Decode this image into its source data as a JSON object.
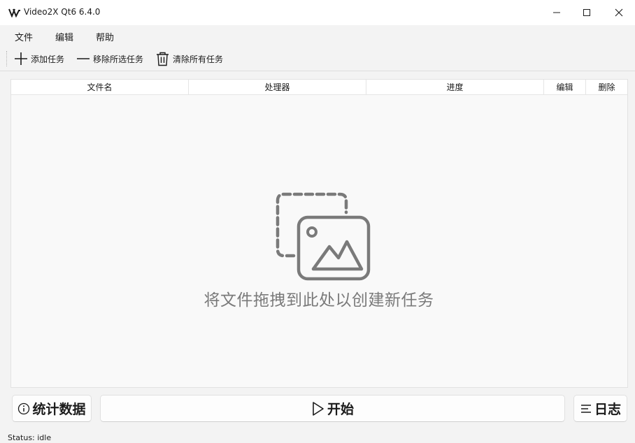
{
  "window": {
    "title": "Video2X Qt6 6.4.0",
    "app_icon": "video2x-logo-icon"
  },
  "title_controls": {
    "minimize": "minimize-icon",
    "maximize": "maximize-icon",
    "close": "close-icon"
  },
  "menu": {
    "items": [
      "文件",
      "编辑",
      "帮助"
    ]
  },
  "toolbar": {
    "add_label": "添加任务",
    "remove_label": "移除所选任务",
    "clear_label": "清除所有任务"
  },
  "table": {
    "columns": [
      "文件名",
      "处理器",
      "进度",
      "编辑",
      "删除"
    ],
    "rows": []
  },
  "drop_zone": {
    "message": "将文件拖拽到此处以创建新任务",
    "icon": "image-drop-icon"
  },
  "buttons": {
    "stats_label": "统计数据",
    "start_label": "开始",
    "log_label": "日志"
  },
  "status_bar": {
    "text": "Status: idle"
  },
  "colors": {
    "window_bg": "#f3f3f3",
    "table_bg": "#f9f9f9",
    "drop_text": "#7a7a7a"
  }
}
